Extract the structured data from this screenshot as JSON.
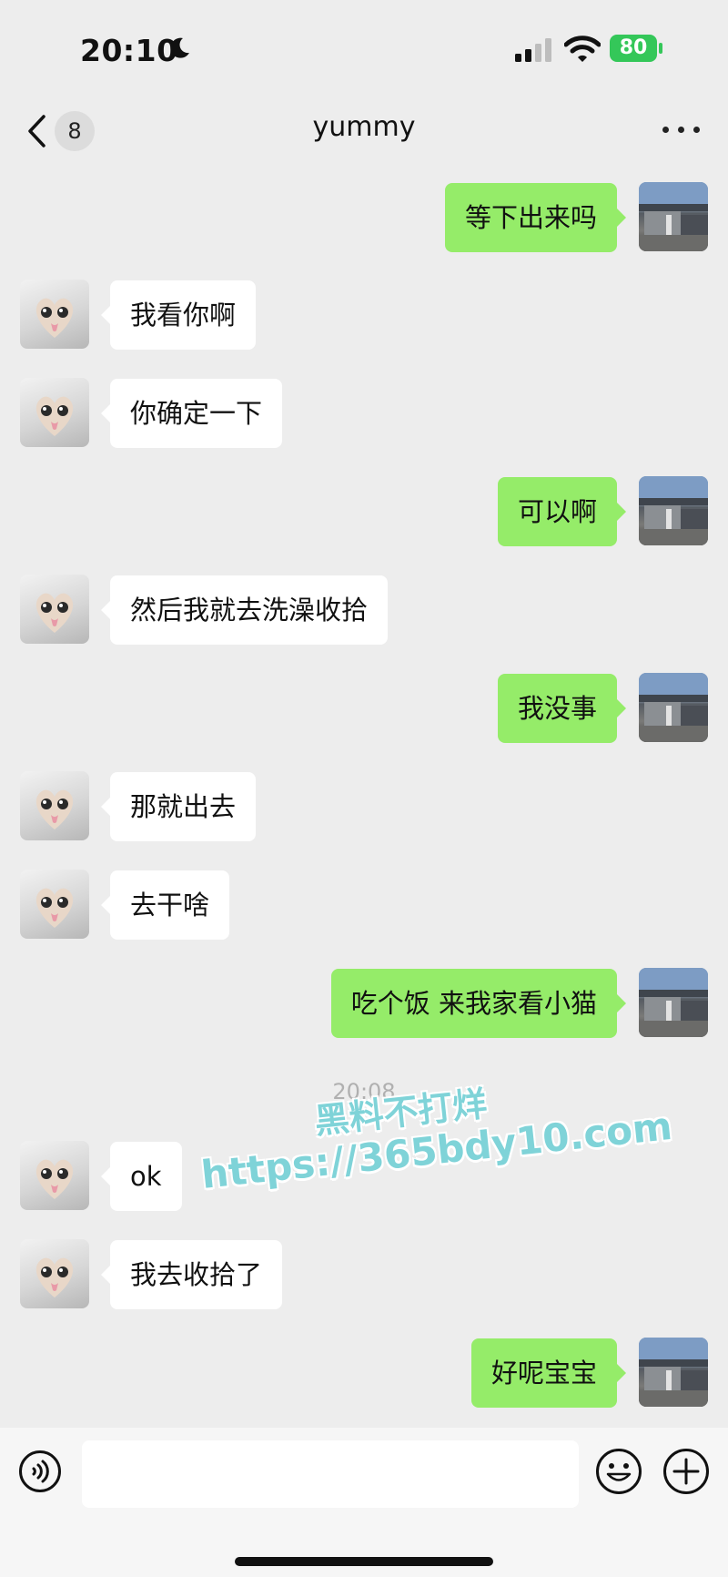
{
  "status_bar": {
    "time": "20:10",
    "battery": "80"
  },
  "header": {
    "unread_count": "8",
    "title": "yummy"
  },
  "messages": [
    {
      "side": "out",
      "text": "等下出来吗"
    },
    {
      "side": "in",
      "text": "我看你啊"
    },
    {
      "side": "in",
      "text": "你确定一下"
    },
    {
      "side": "out",
      "text": "可以啊"
    },
    {
      "side": "in",
      "text": "然后我就去洗澡收拾"
    },
    {
      "side": "out",
      "text": "我没事"
    },
    {
      "side": "in",
      "text": "那就出去"
    },
    {
      "side": "in",
      "text": "去干啥"
    },
    {
      "side": "out",
      "text": "吃个饭 来我家看小猫"
    },
    {
      "side": "in",
      "text": "ok"
    },
    {
      "side": "in",
      "text": "我去收拾了"
    },
    {
      "side": "out",
      "text": "好呢宝宝"
    }
  ],
  "timestamp": "20:08",
  "watermark": {
    "line1": "黑料不打烊",
    "line2": "https://365bdy10.com"
  },
  "input": {
    "value": "",
    "placeholder": ""
  },
  "icons": {
    "voice": "voice-icon",
    "emoji": "emoji-icon",
    "plus": "plus-icon"
  }
}
